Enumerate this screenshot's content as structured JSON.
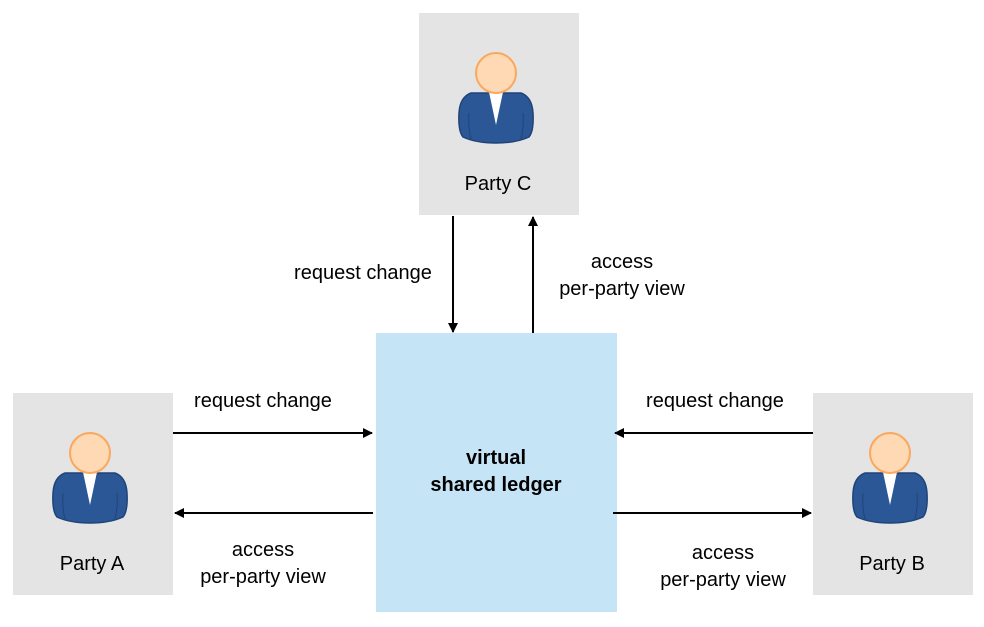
{
  "parties": {
    "c": {
      "label": "Party C"
    },
    "a": {
      "label": "Party A"
    },
    "b": {
      "label": "Party B"
    }
  },
  "ledger": {
    "line1": "virtual",
    "line2": "shared ledger"
  },
  "edges": {
    "c_request": "request change",
    "c_access_1": "access",
    "c_access_2": "per-party view",
    "a_request": "request change",
    "a_access_1": "access",
    "a_access_2": "per-party view",
    "b_request": "request change",
    "b_access_1": "access",
    "b_access_2": "per-party view"
  },
  "icons": {
    "party": "person-icon"
  },
  "colors": {
    "party_box": "#e4e4e4",
    "ledger_box": "#c5e4f6",
    "suit": "#2b5797",
    "face": "#ffd8b4",
    "face_outline": "#f9a85e"
  }
}
